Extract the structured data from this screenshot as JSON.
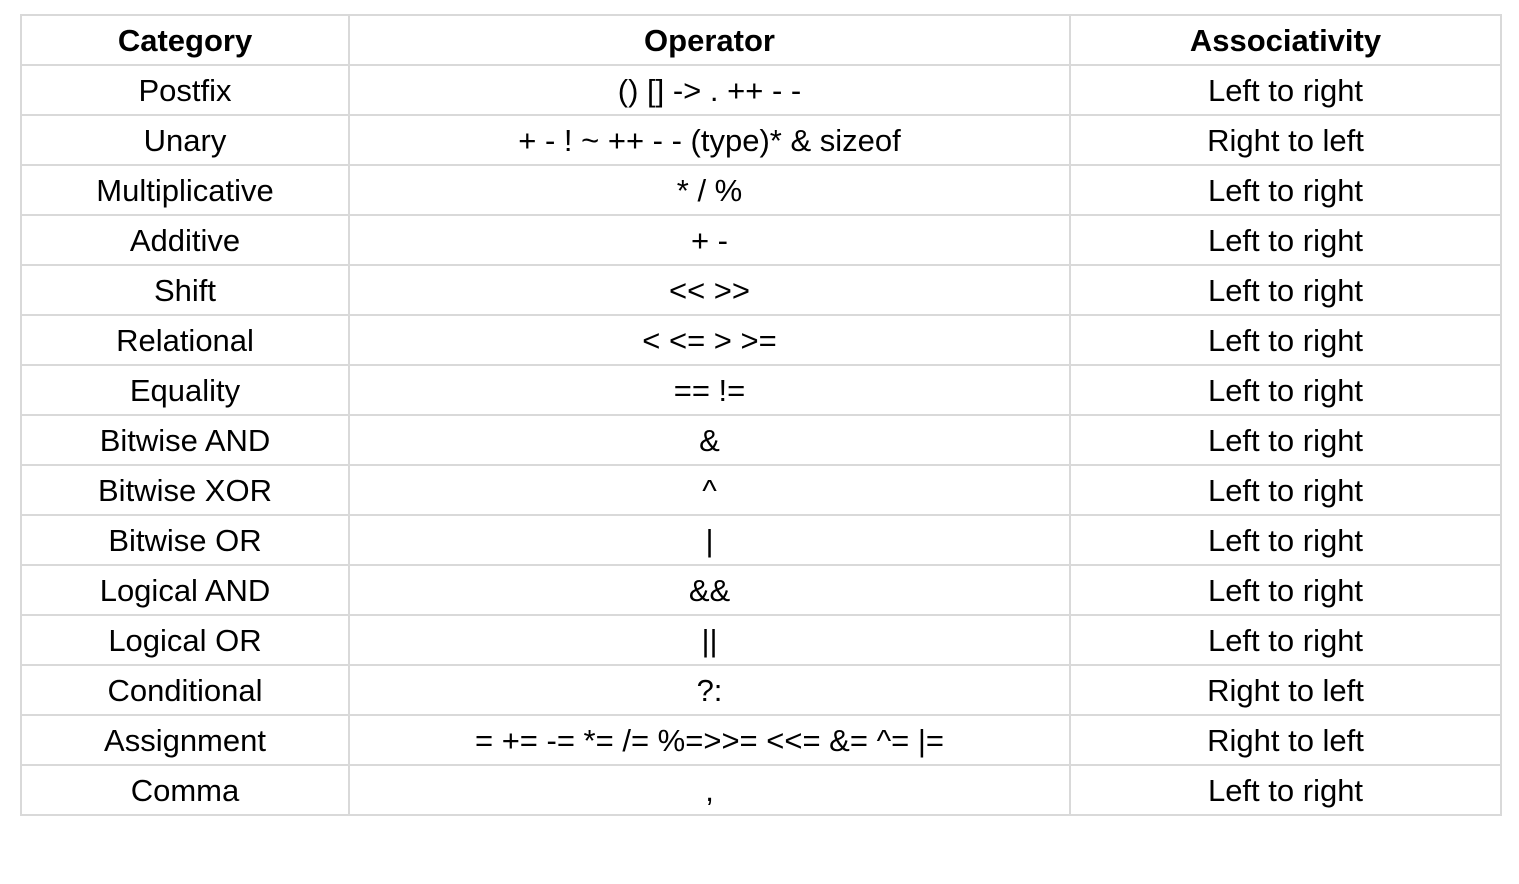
{
  "table": {
    "headers": [
      "Category",
      "Operator",
      "Associativity"
    ],
    "rows": [
      [
        "Postfix",
        "() [] -> . ++ - -",
        "Left to right"
      ],
      [
        "Unary",
        "+ - ! ~ ++ - - (type)* & sizeof",
        "Right to left"
      ],
      [
        "Multiplicative",
        "* / %",
        "Left to right"
      ],
      [
        "Additive",
        "+ -",
        "Left to right"
      ],
      [
        "Shift",
        "<< >>",
        "Left to right"
      ],
      [
        "Relational",
        "< <= > >=",
        "Left to right"
      ],
      [
        "Equality",
        "== !=",
        "Left to right"
      ],
      [
        "Bitwise AND",
        "&",
        "Left to right"
      ],
      [
        "Bitwise XOR",
        "^",
        "Left to right"
      ],
      [
        "Bitwise OR",
        "|",
        "Left to right"
      ],
      [
        "Logical AND",
        "&&",
        "Left to right"
      ],
      [
        "Logical OR",
        "||",
        "Left to right"
      ],
      [
        "Conditional",
        "?:",
        "Right to left"
      ],
      [
        "Assignment",
        "= += -= *= /= %=>>= <<= &= ^= |=",
        "Right to left"
      ],
      [
        "Comma",
        ",",
        "Left to right"
      ]
    ]
  },
  "colors": {
    "border": "#d9d9d9",
    "text": "#000000",
    "background": "#ffffff"
  }
}
